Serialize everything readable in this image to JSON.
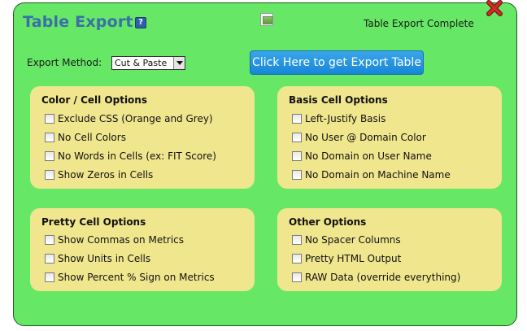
{
  "dialog": {
    "title": "Table Export",
    "help_icon_glyph": "?",
    "status": "Table Export Complete",
    "colors": {
      "background": "#66e866",
      "title": "#3a6fa8",
      "panel": "#f0e68e",
      "button": "#1786d6",
      "close": "#d42a2a"
    }
  },
  "export": {
    "label": "Export Method:",
    "selected": "Cut & Paste",
    "button_label": "Click Here to get Export Table"
  },
  "panels": {
    "color_cell": {
      "title": "Color / Cell Options",
      "options": [
        {
          "label": "Exclude CSS (Orange and Grey)",
          "checked": false
        },
        {
          "label": "No Cell Colors",
          "checked": false
        },
        {
          "label": "No Words in Cells (ex: FIT Score)",
          "checked": false
        },
        {
          "label": "Show Zeros in Cells",
          "checked": false
        }
      ]
    },
    "basis_cell": {
      "title": "Basis Cell Options",
      "options": [
        {
          "label": "Left-Justify Basis",
          "checked": false
        },
        {
          "label": "No User @ Domain Color",
          "checked": false
        },
        {
          "label": "No Domain on User Name",
          "checked": false
        },
        {
          "label": "No Domain on Machine Name",
          "checked": false
        }
      ]
    },
    "pretty_cell": {
      "title": "Pretty Cell Options",
      "options": [
        {
          "label": "Show Commas on Metrics",
          "checked": false
        },
        {
          "label": "Show Units in Cells",
          "checked": false
        },
        {
          "label": "Show Percent % Sign on Metrics",
          "checked": false
        }
      ]
    },
    "other": {
      "title": "Other Options",
      "options": [
        {
          "label": "No Spacer Columns",
          "checked": false
        },
        {
          "label": "Pretty HTML Output",
          "checked": false
        },
        {
          "label": "RAW Data (override everything)",
          "checked": false
        }
      ]
    }
  },
  "icons": {
    "help": "help-icon",
    "broken_image": "broken-image-icon",
    "close": "close-x-icon",
    "dropdown": "chevron-down-icon"
  }
}
